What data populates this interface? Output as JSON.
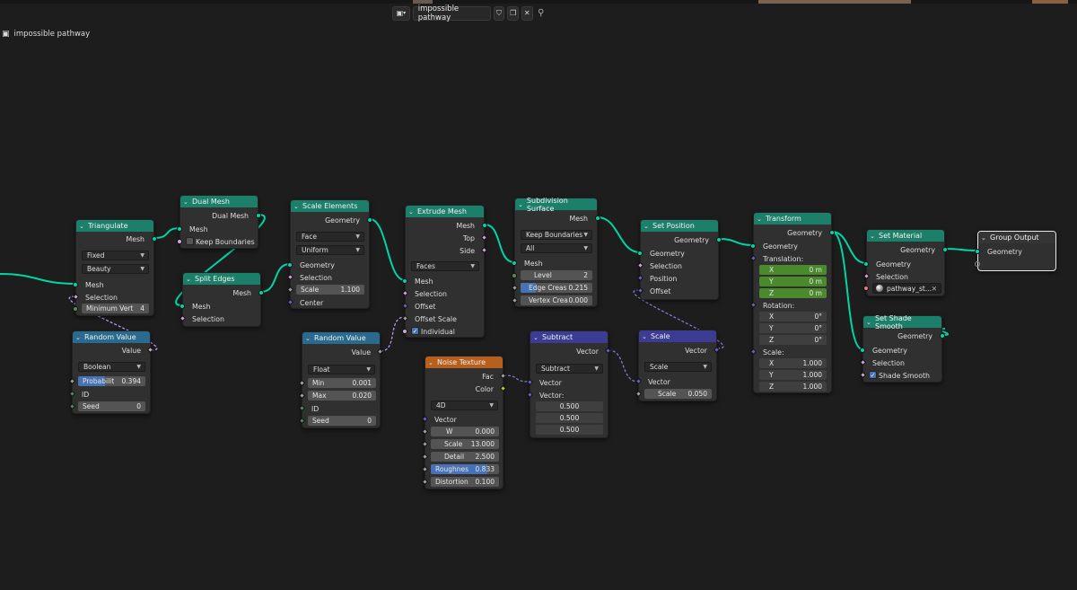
{
  "header": {
    "tree_name": "impossible pathway",
    "breadcrumb": "impossible pathway"
  },
  "colors": {
    "background": "#1d1d1d",
    "node_body": "#303030",
    "geometry_header": "#1c7f69",
    "function_header": "#2a6a8e",
    "texture_header": "#b75f1d",
    "vector_header": "#3c3c94",
    "geometry_link": "#00d6a3",
    "field_link": "#c9a0ff"
  },
  "nodes": {
    "triangulate": {
      "title": "Triangulate",
      "out_mesh": "Mesh",
      "quad_method": "Fixed",
      "ngon_method": "Beauty",
      "in_mesh": "Mesh",
      "in_selection": "Selection",
      "min_vert_label": "Minimum Vert",
      "min_vert_value": "4"
    },
    "random_value_1": {
      "title": "Random Value",
      "out_value": "Value",
      "data_type": "Boolean",
      "prob_label": "Probabilit",
      "prob_value": "0.394",
      "prob_fraction": 0.394,
      "id_label": "ID",
      "seed_label": "Seed",
      "seed_value": "0"
    },
    "dual_mesh": {
      "title": "Dual Mesh",
      "out_dual_mesh": "Dual Mesh",
      "in_mesh": "Mesh",
      "keep_boundaries": "Keep Boundaries"
    },
    "split_edges": {
      "title": "Split Edges",
      "out_mesh": "Mesh",
      "in_mesh": "Mesh",
      "in_selection": "Selection"
    },
    "scale_elements": {
      "title": "Scale Elements",
      "out_geometry": "Geometry",
      "domain": "Face",
      "scale_mode": "Uniform",
      "in_geometry": "Geometry",
      "in_selection": "Selection",
      "scale_label": "Scale",
      "scale_value": "1.100",
      "center_label": "Center"
    },
    "random_value_2": {
      "title": "Random Value",
      "out_value": "Value",
      "data_type": "Float",
      "min_label": "Min",
      "min_value": "0.001",
      "max_label": "Max",
      "max_value": "0.020",
      "id_label": "ID",
      "seed_label": "Seed",
      "seed_value": "0"
    },
    "extrude_mesh": {
      "title": "Extrude Mesh",
      "out_mesh": "Mesh",
      "out_top": "Top",
      "out_side": "Side",
      "mode": "Faces",
      "in_mesh": "Mesh",
      "in_selection": "Selection",
      "in_offset": "Offset",
      "in_offset_scale": "Offset Scale",
      "individual": "Individual"
    },
    "noise_texture": {
      "title": "Noise Texture",
      "out_fac": "Fac",
      "out_color": "Color",
      "dimensions": "4D",
      "in_vector": "Vector",
      "w_label": "W",
      "w_value": "0.000",
      "scale_label": "Scale",
      "scale_value": "13.000",
      "detail_label": "Detail",
      "detail_value": "2.500",
      "roughness_label": "Roughnes",
      "roughness_value": "0.833",
      "roughness_fraction": 0.833,
      "distortion_label": "Distortion",
      "distortion_value": "0.100"
    },
    "subdivision_surface": {
      "title": "Subdivision Surface",
      "out_mesh": "Mesh",
      "boundary": "Keep Boundaries",
      "uv_smooth": "All",
      "in_mesh": "Mesh",
      "level_label": "Level",
      "level_value": "2",
      "edge_crease_label": "Edge Creas",
      "edge_crease_value": "0.215",
      "edge_crease_fraction": 0.215,
      "vertex_crease_label": "Vertex Crea",
      "vertex_crease_value": "0.000"
    },
    "subtract": {
      "title": "Subtract",
      "out_vector": "Vector",
      "operation": "Subtract",
      "in_vector_a": "Vector",
      "in_vector_b": "Vector:",
      "vx": "0.500",
      "vy": "0.500",
      "vz": "0.500"
    },
    "set_position": {
      "title": "Set Position",
      "out_geometry": "Geometry",
      "in_geometry": "Geometry",
      "in_selection": "Selection",
      "in_position": "Position",
      "in_offset": "Offset"
    },
    "scale_vec": {
      "title": "Scale",
      "out_vector": "Vector",
      "operation": "Scale",
      "in_vector": "Vector",
      "scale_label": "Scale",
      "scale_value": "0.050"
    },
    "transform": {
      "title": "Transform",
      "out_geometry": "Geometry",
      "in_geometry": "Geometry",
      "translation_label": "Translation:",
      "tx": "0 m",
      "ty": "0 m",
      "tz": "0 m",
      "rotation_label": "Rotation:",
      "rx": "0°",
      "ry": "0°",
      "rz": "0°",
      "scale_label": "Scale:",
      "sx": "1.000",
      "sy": "1.000",
      "sz": "1.000",
      "x": "X",
      "y": "Y",
      "z": "Z"
    },
    "set_material": {
      "title": "Set Material",
      "out_geometry": "Geometry",
      "in_geometry": "Geometry",
      "in_selection": "Selection",
      "material": "pathway_st...",
      "clear": "✕"
    },
    "set_shade_smooth": {
      "title": "Set Shade Smooth",
      "out_geometry": "Geometry",
      "in_geometry": "Geometry",
      "in_selection": "Selection",
      "shade_smooth": "Shade Smooth"
    },
    "group_output": {
      "title": "Group Output",
      "in_geometry": "Geometry"
    }
  }
}
